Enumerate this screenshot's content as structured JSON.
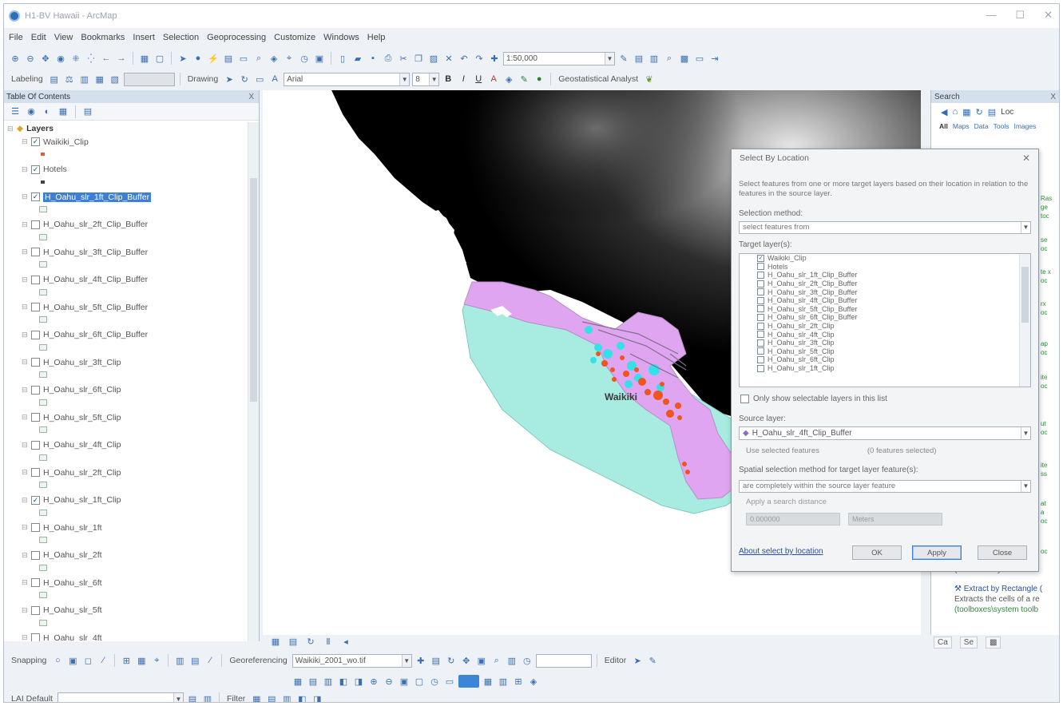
{
  "window": {
    "title": "H1-BV Hawaii - ArcMap",
    "controls": [
      "—",
      "☐",
      "✕"
    ]
  },
  "menu": [
    "File",
    "Edit",
    "View",
    "Bookmarks",
    "Insert",
    "Selection",
    "Geoprocessing",
    "Customize",
    "Windows",
    "Help"
  ],
  "toolbar1": {
    "scale_value": "1:50,000"
  },
  "toolbar2": {
    "labeling_label": "Labeling",
    "drawing_label": "Drawing",
    "font_name": "Arial",
    "font_size": "8",
    "bold": "B",
    "italic": "I",
    "underline": "U",
    "geostat_label": "Geostatistical Analyst"
  },
  "toc": {
    "title": "Table Of Contents",
    "close": "X",
    "root_label": "Layers",
    "layers": [
      {
        "name": "Waikiki_Clip",
        "checked": true,
        "swatch": "#e05a2a",
        "swatch_type": "point"
      },
      {
        "name": "Hotels",
        "checked": true,
        "swatch": "#444444",
        "swatch_type": "point"
      },
      {
        "name": "H_Oahu_slr_1ft_Clip_Buffer",
        "checked": true,
        "selected": true,
        "swatch": "#eef4ef"
      },
      {
        "name": "H_Oahu_slr_2ft_Clip_Buffer",
        "checked": false,
        "swatch": "#eef4ef"
      },
      {
        "name": "H_Oahu_slr_3ft_Clip_Buffer",
        "checked": false,
        "swatch": "#eef4ef"
      },
      {
        "name": "H_Oahu_slr_4ft_Clip_Buffer",
        "checked": false,
        "swatch": "#eef4ef"
      },
      {
        "name": "H_Oahu_slr_5ft_Clip_Buffer",
        "checked": false,
        "swatch": "#eef4ef"
      },
      {
        "name": "H_Oahu_slr_6ft_Clip_Buffer",
        "checked": false,
        "swatch": "#eef4ef"
      },
      {
        "name": "H_Oahu_slr_3ft_Clip",
        "checked": false,
        "swatch": "#eef4ef"
      },
      {
        "name": "H_Oahu_slr_6ft_Clip",
        "checked": false,
        "swatch": "#eef4ef"
      },
      {
        "name": "H_Oahu_slr_5ft_Clip",
        "checked": false,
        "swatch": "#eef4ef"
      },
      {
        "name": "H_Oahu_slr_4ft_Clip",
        "checked": false,
        "swatch": "#eef4ef"
      },
      {
        "name": "H_Oahu_slr_2ft_Clip",
        "checked": false,
        "swatch": "#eef4ef"
      },
      {
        "name": "H_Oahu_slr_1ft_Clip",
        "checked": true,
        "swatch": "#eef4ef"
      },
      {
        "name": "H_Oahu_slr_1ft",
        "checked": false,
        "swatch": "#eef4ef"
      },
      {
        "name": "H_Oahu_slr_2ft",
        "checked": false,
        "swatch": "#eef4ef"
      },
      {
        "name": "H_Oahu_slr_6ft",
        "checked": false,
        "swatch": "#eef4ef"
      },
      {
        "name": "H_Oahu_slr_5ft",
        "checked": false,
        "swatch": "#eef4ef"
      },
      {
        "name": "H_Oahu_slr_4ft",
        "checked": false,
        "swatch": "#eef4ef"
      }
    ]
  },
  "map": {
    "place_label": "Waikiki",
    "colors": {
      "land": "#ffffff",
      "purple": "#dfa5f0",
      "aqua": "#a8ece1",
      "cyan": "#35e0e8",
      "orange": "#f0541f"
    }
  },
  "dialog": {
    "title": "Select By Location",
    "close": "✕",
    "description": "Select features from one or more target layers based on their location in relation to the features in the source layer.",
    "selection_method_label": "Selection method:",
    "selection_method_value": "select features from",
    "target_layers_label": "Target layer(s):",
    "target_layers": [
      {
        "name": "Waikiki_Clip",
        "checked": true
      },
      {
        "name": "Hotels",
        "checked": false
      },
      {
        "name": "H_Oahu_slr_1ft_Clip_Buffer",
        "checked": false
      },
      {
        "name": "H_Oahu_slr_2ft_Clip_Buffer",
        "checked": false
      },
      {
        "name": "H_Oahu_slr_3ft_Clip_Buffer",
        "checked": false
      },
      {
        "name": "H_Oahu_slr_4ft_Clip_Buffer",
        "checked": false
      },
      {
        "name": "H_Oahu_slr_5ft_Clip_Buffer",
        "checked": false
      },
      {
        "name": "H_Oahu_slr_6ft_Clip_Buffer",
        "checked": false
      },
      {
        "name": "H_Oahu_slr_2ft_Clip",
        "checked": false
      },
      {
        "name": "H_Oahu_slr_4ft_Clip",
        "checked": false
      },
      {
        "name": "H_Oahu_slr_3ft_Clip",
        "checked": false
      },
      {
        "name": "H_Oahu_slr_5ft_Clip",
        "checked": false
      },
      {
        "name": "H_Oahu_slr_6ft_Clip",
        "checked": false
      },
      {
        "name": "H_Oahu_slr_1ft_Clip",
        "checked": false
      }
    ],
    "only_selectable_label": "Only show selectable layers in this list",
    "source_layer_label": "Source layer:",
    "source_layer_value": "H_Oahu_slr_4ft_Clip_Buffer",
    "use_selected_label": "Use selected features",
    "features_selected": "(0 features selected)",
    "spatial_method_label": "Spatial selection method for target layer feature(s):",
    "spatial_method_value": "are completely within the source layer feature",
    "apply_distance_label": "Apply a search distance",
    "distance_value": "0.000000",
    "units_value": "Meters",
    "help_link": "About select by location",
    "ok": "OK",
    "apply": "Apply",
    "close_button": "Close"
  },
  "search_panel": {
    "title": "Search",
    "close": "X",
    "tabs": [
      "All",
      "Maps",
      "Data",
      "Tools",
      "Images"
    ],
    "local": "Loc",
    "result1_path": "(toolboxes\\system toolb",
    "result2_title": "Extract by Rectangle (",
    "result2_desc": "Extracts the cells of a re",
    "result3_path": "(toolboxes\\system toolb"
  },
  "bottom": {
    "snapping_label": "Snapping",
    "georef_label": "Georeferencing",
    "georef_layer": "Waikiki_2001_wo.tif",
    "lai_label": "LAI Default",
    "filter_label": "Filter",
    "editor_label": "Editor",
    "tab_catalog": "Ca",
    "tab_search": "Se"
  }
}
